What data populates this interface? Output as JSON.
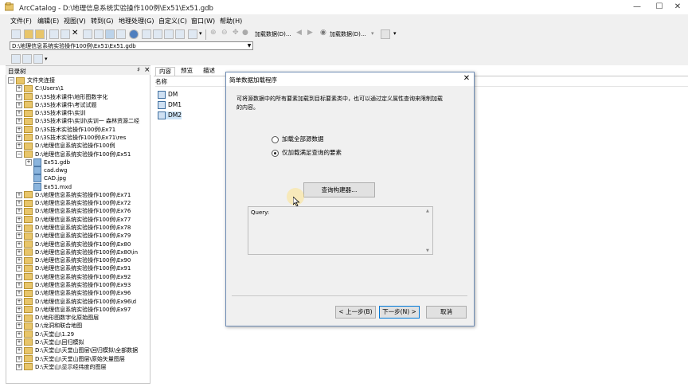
{
  "window": {
    "title": "ArcCatalog - D:\\地理信息系统实验操作100例\\Ex51\\Ex51.gdb",
    "minimize": "—",
    "maximize": "☐",
    "close": "✕"
  },
  "menu": [
    "文件(F)",
    "编辑(E)",
    "视图(V)",
    "转到(G)",
    "地理处理(G)",
    "自定义(C)",
    "窗口(W)",
    "帮助(H)"
  ],
  "toolbar": {
    "add_data_label": "加载数据(D)...",
    "add_data2_label": "加载数据(D)..."
  },
  "location": {
    "path": "D:\\地理信息系统实验操作100例\\Ex51\\Ex51.gdb"
  },
  "tree": {
    "title": "目录树",
    "pin": "♯",
    "close": "×",
    "items": [
      {
        "label": "文件夹连接",
        "level": 0,
        "expanded": true
      },
      {
        "label": "C:\\Users\\1",
        "level": 1
      },
      {
        "label": "D:\\3S技术课件\\地形图数字化",
        "level": 1
      },
      {
        "label": "D:\\3S技术课件\\考试试题",
        "level": 1
      },
      {
        "label": "D:\\3S技术课件\\实训",
        "level": 1
      },
      {
        "label": "D:\\3S技术课件\\实训\\实训一 森林资源二经",
        "level": 1
      },
      {
        "label": "D:\\3S技术实验操作100例\\Ex71",
        "level": 1
      },
      {
        "label": "D:\\3S技术实验操作100例\\Ex71\\res",
        "level": 1
      },
      {
        "label": "D:\\地理信息系统实验操作100例",
        "level": 1
      },
      {
        "label": "D:\\地理信息系统实验操作100例\\Ex51",
        "level": 1,
        "expanded": true
      },
      {
        "label": "Ex51.gdb",
        "level": 2,
        "type": "gdb"
      },
      {
        "label": "cad.dwg",
        "level": 2,
        "type": "dwg"
      },
      {
        "label": "CAD.jpg",
        "level": 2,
        "type": "jpg"
      },
      {
        "label": "Ex51.mxd",
        "level": 2,
        "type": "mxd"
      },
      {
        "label": "D:\\地理信息系统实验操作100例\\Ex71",
        "level": 1
      },
      {
        "label": "D:\\地理信息系统实验操作100例\\Ex72",
        "level": 1
      },
      {
        "label": "D:\\地理信息系统实验操作100例\\Ex76",
        "level": 1
      },
      {
        "label": "D:\\地理信息系统实验操作100例\\Ex77",
        "level": 1
      },
      {
        "label": "D:\\地理信息系统实验操作100例\\Ex78",
        "level": 1
      },
      {
        "label": "D:\\地理信息系统实验操作100例\\Ex79",
        "level": 1
      },
      {
        "label": "D:\\地理信息系统实验操作100例\\Ex80",
        "level": 1
      },
      {
        "label": "D:\\地理信息系统实验操作100例\\Ex80\\in",
        "level": 1
      },
      {
        "label": "D:\\地理信息系统实验操作100例\\Ex90",
        "level": 1
      },
      {
        "label": "D:\\地理信息系统实验操作100例\\Ex91",
        "level": 1
      },
      {
        "label": "D:\\地理信息系统实验操作100例\\Ex92",
        "level": 1
      },
      {
        "label": "D:\\地理信息系统实验操作100例\\Ex93",
        "level": 1
      },
      {
        "label": "D:\\地理信息系统实验操作100例\\Ex96",
        "level": 1
      },
      {
        "label": "D:\\地理信息系统实验操作100例\\Ex96\\d",
        "level": 1
      },
      {
        "label": "D:\\地理信息系统实验操作100例\\Ex97",
        "level": 1
      },
      {
        "label": "D:\\地形图数字化原始图层",
        "level": 1
      },
      {
        "label": "D:\\龙洞和联合地图",
        "level": 1
      },
      {
        "label": "D:\\天堂山\\1.29",
        "level": 1
      },
      {
        "label": "D:\\天堂山\\回归模拟",
        "level": 1
      },
      {
        "label": "D:\\天堂山\\天堂山图层\\回归模拟\\全部数据",
        "level": 1
      },
      {
        "label": "D:\\天堂山\\天堂山图层\\原始矢量图层",
        "level": 1
      },
      {
        "label": "D:\\天堂山\\显示经纬度的图层",
        "level": 1
      }
    ]
  },
  "content": {
    "tabs": [
      "内容",
      "预览",
      "描述"
    ],
    "column_name": "名称",
    "items": [
      "DM",
      "DM1",
      "DM2"
    ]
  },
  "dialog": {
    "title": "简单数据加载程序",
    "description": "可将源数据中的所有要素加载到目标要素类中，也可以通过定义属性查询来限制加载的内容。",
    "radio_all": "加载全部源数据",
    "radio_query": "仅加载满足查询的要素",
    "query_builder_button": "查询构建器...",
    "query_label": "Query:",
    "back_button": "< 上一步(B)",
    "next_button": "下一步(N) >",
    "cancel_button": "取消"
  },
  "colors": {
    "accent": "#6f8db5",
    "folder": "#e8c56a",
    "dialog_bg": "#f0f0f0",
    "default_button_border": "#0078d7"
  }
}
